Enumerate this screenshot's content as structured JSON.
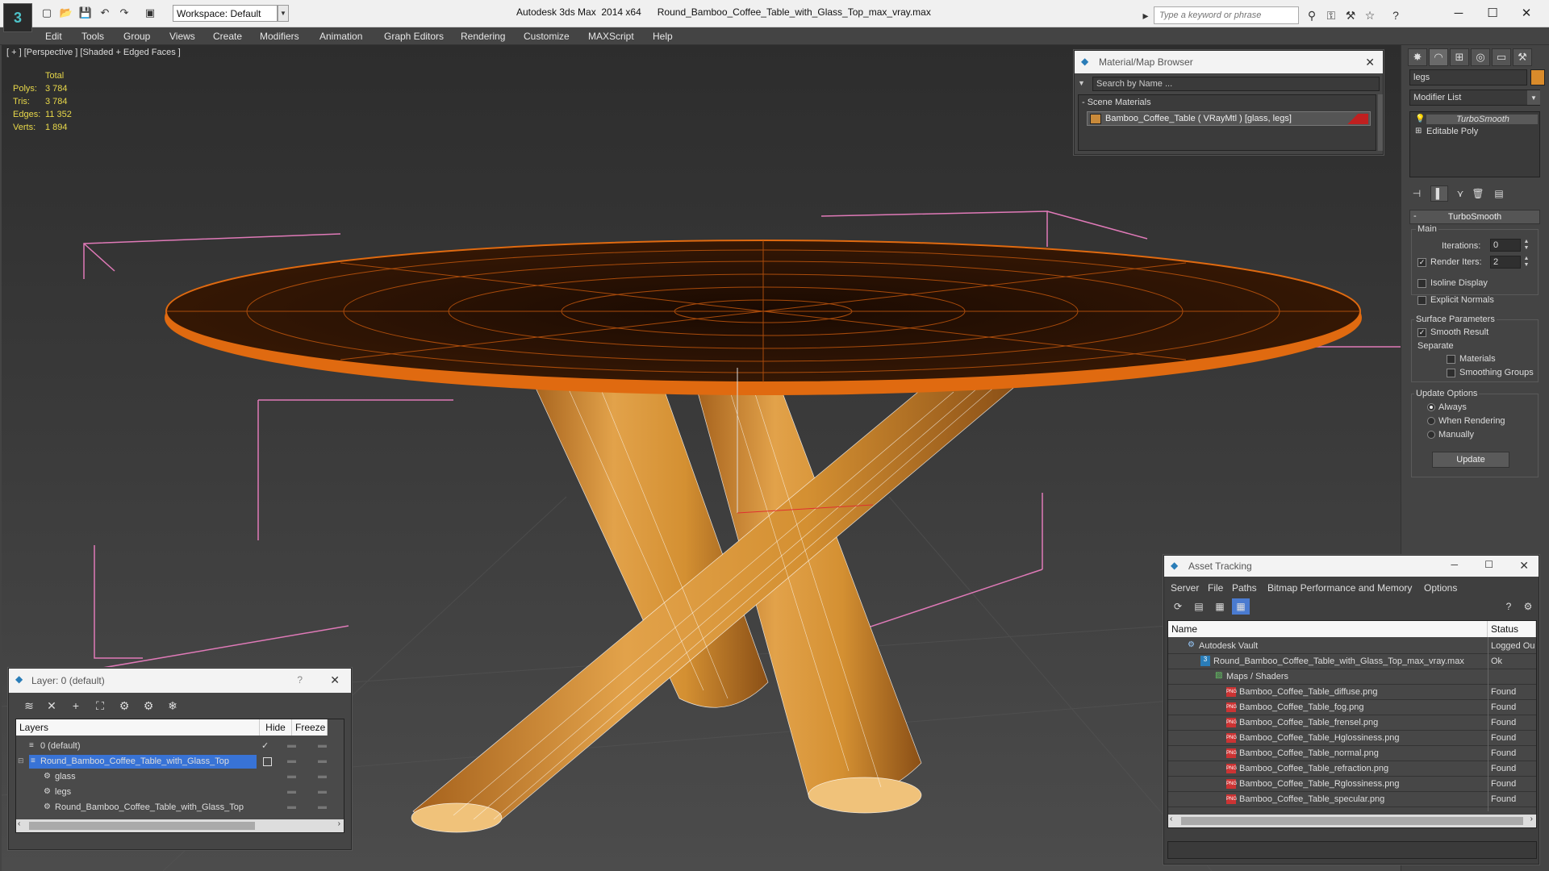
{
  "app": {
    "window_title": "Autodesk 3ds Max  2014 x64      Round_Bamboo_Coffee_Table_with_Glass_Top_max_vray.max",
    "workspace": "Workspace: Default",
    "search_placeholder": "Type a keyword or phrase",
    "logo": "3"
  },
  "menu": [
    "Edit",
    "Tools",
    "Group",
    "Views",
    "Create",
    "Modifiers",
    "Animation",
    "Graph Editors",
    "Rendering",
    "Customize",
    "MAXScript",
    "Help"
  ],
  "viewport": {
    "label": "[ + ] [Perspective ] [Shaded + Edged Faces ]",
    "stats": {
      "header": "Total",
      "rows": [
        {
          "label": "Polys:",
          "value": "3 784"
        },
        {
          "label": "Tris:",
          "value": "3 784"
        },
        {
          "label": "Edges:",
          "value": "11 352"
        },
        {
          "label": "Verts:",
          "value": "1 894"
        }
      ]
    }
  },
  "material_browser": {
    "title": "Material/Map Browser",
    "search_placeholder": "Search by Name ...",
    "section": "- Scene Materials",
    "item": "Bamboo_Coffee_Table  ( VRayMtl ) [glass, legs]"
  },
  "command_panel": {
    "object_name": "legs",
    "modifier_list": "Modifier List",
    "stack": [
      "TurboSmooth",
      "Editable Poly"
    ],
    "turbosmooth": {
      "title": "TurboSmooth",
      "main_label": "Main",
      "iterations_label": "Iterations:",
      "iterations": "0",
      "render_iters_label": "Render Iters:",
      "render_iters": "2",
      "render_iters_checked": true,
      "isoline_label": "Isoline Display",
      "isoline_checked": false,
      "explicit_normals_label": "Explicit Normals",
      "explicit_normals_checked": false,
      "surface_label": "Surface Parameters",
      "smooth_result_label": "Smooth Result",
      "smooth_result_checked": true,
      "separate_label": "Separate",
      "materials_label": "Materials",
      "smoothing_groups_label": "Smoothing Groups",
      "update_options_label": "Update Options",
      "always_label": "Always",
      "when_rendering_label": "When Rendering",
      "manually_label": "Manually",
      "selected_update": "Always",
      "update_button": "Update"
    }
  },
  "layer_panel": {
    "title": "Layer: 0 (default)",
    "help": "?",
    "col_layers": "Layers",
    "col_hide": "Hide",
    "col_freeze": "Freeze",
    "rows": [
      {
        "name": "0 (default)",
        "indent": 0
      },
      {
        "name": "Round_Bamboo_Coffee_Table_with_Glass_Top",
        "indent": 0,
        "selected": true
      },
      {
        "name": "glass",
        "indent": 1
      },
      {
        "name": "legs",
        "indent": 1
      },
      {
        "name": "Round_Bamboo_Coffee_Table_with_Glass_Top",
        "indent": 1
      }
    ]
  },
  "asset_tracking": {
    "title": "Asset Tracking",
    "menu": [
      "Server",
      "File",
      "Paths",
      "Bitmap Performance and Memory",
      "Options"
    ],
    "col_name": "Name",
    "col_status": "Status",
    "rows": [
      {
        "name": "Autodesk Vault",
        "status": "Logged Ou",
        "level": 0
      },
      {
        "name": "Round_Bamboo_Coffee_Table_with_Glass_Top_max_vray.max",
        "status": "Ok",
        "level": 1
      },
      {
        "name": "Maps / Shaders",
        "status": "",
        "level": 2
      },
      {
        "name": "Bamboo_Coffee_Table_diffuse.png",
        "status": "Found",
        "level": 3
      },
      {
        "name": "Bamboo_Coffee_Table_fog.png",
        "status": "Found",
        "level": 3
      },
      {
        "name": "Bamboo_Coffee_Table_frensel.png",
        "status": "Found",
        "level": 3
      },
      {
        "name": "Bamboo_Coffee_Table_Hglossiness.png",
        "status": "Found",
        "level": 3
      },
      {
        "name": "Bamboo_Coffee_Table_normal.png",
        "status": "Found",
        "level": 3
      },
      {
        "name": "Bamboo_Coffee_Table_refraction.png",
        "status": "Found",
        "level": 3
      },
      {
        "name": "Bamboo_Coffee_Table_Rglossiness.png",
        "status": "Found",
        "level": 3
      },
      {
        "name": "Bamboo_Coffee_Table_specular.png",
        "status": "Found",
        "level": 3
      }
    ]
  },
  "colors": {
    "selection": "#3873d6",
    "stat_yellow": "#e8d84a",
    "wood": "#d99a3e",
    "wire_orange": "#e06a10",
    "bbox_pink": "#e07ab8"
  }
}
